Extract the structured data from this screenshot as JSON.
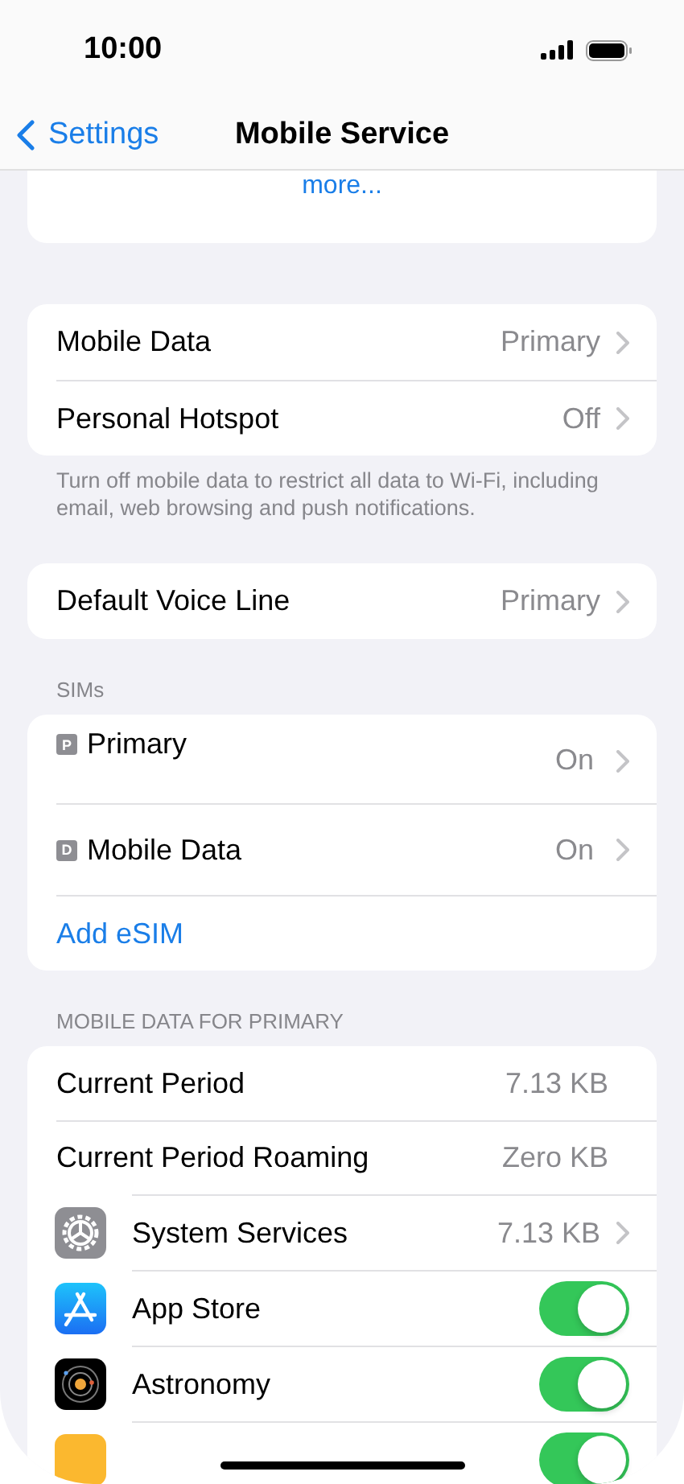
{
  "status_bar": {
    "time": "10:00"
  },
  "nav": {
    "back": "Settings",
    "title": "Mobile Service"
  },
  "top_card": {
    "link": "more..."
  },
  "groups": [
    {
      "rows": [
        {
          "kind": "value",
          "label": "Mobile Data",
          "value": "Primary"
        },
        {
          "kind": "value",
          "label": "Personal Hotspot",
          "value": "Off"
        }
      ],
      "footer": "Turn off mobile data to restrict all data to Wi-Fi, including email, web browsing and push notifications."
    },
    {
      "rows": [
        {
          "kind": "value",
          "label": "Default Voice Line",
          "value": "Primary"
        }
      ]
    },
    {
      "header": "SIMs",
      "rows": [
        {
          "kind": "sim",
          "badge": "P",
          "label": "Primary",
          "value": "On"
        },
        {
          "kind": "sim",
          "badge": "D",
          "label": "Mobile Data",
          "value": "On"
        },
        {
          "kind": "link",
          "label": "Add eSIM"
        }
      ]
    },
    {
      "header": "MOBILE DATA FOR PRIMARY",
      "rows": [
        {
          "kind": "stat",
          "label": "Current Period",
          "value": "7.13 KB"
        },
        {
          "kind": "stat",
          "label": "Current Period Roaming",
          "value": "Zero KB"
        },
        {
          "kind": "app",
          "label": "System Services",
          "value": "7.13 KB"
        },
        {
          "kind": "toggle",
          "label": "App Store",
          "on": true
        },
        {
          "kind": "toggle",
          "label": "Astronomy",
          "on": true
        },
        {
          "kind": "toggle",
          "on": true
        }
      ]
    }
  ]
}
